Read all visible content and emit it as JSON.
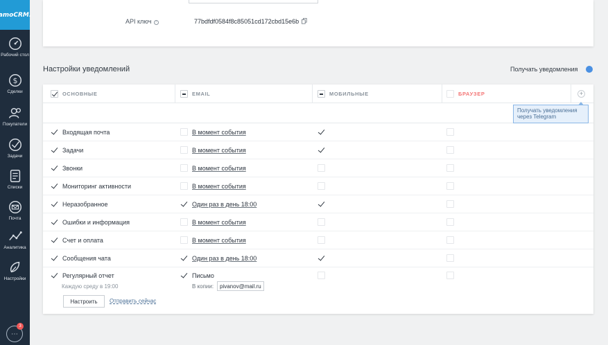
{
  "app": {
    "logo_text": "amoCRM.",
    "accent_color": "#229bd6",
    "sidebar_color": "#1f2d3d"
  },
  "sidebar": {
    "items": [
      {
        "label": "Рабочий стол",
        "icon": "dashboard-icon"
      },
      {
        "label": "Сделки",
        "icon": "deals-icon"
      },
      {
        "label": "Покупатели",
        "icon": "customers-icon"
      },
      {
        "label": "Задачи",
        "icon": "tasks-icon"
      },
      {
        "label": "Списки",
        "icon": "lists-icon"
      },
      {
        "label": "Почта",
        "icon": "mail-icon"
      },
      {
        "label": "Аналитика",
        "icon": "analytics-icon"
      },
      {
        "label": "Настройки",
        "icon": "settings-icon"
      }
    ],
    "chat_badge": "3"
  },
  "api": {
    "label": "API ключ",
    "key": "77bdfdf0584f8c85051cd172cbd15e6b"
  },
  "notifications": {
    "title": "Настройки уведомлений",
    "receive_label": "Получать уведомления",
    "columns": [
      {
        "label": "ОСНОВНЫЕ",
        "state": "checked"
      },
      {
        "label": "EMAIL",
        "state": "partial"
      },
      {
        "label": "МОБИЛЬНЫЕ",
        "state": "partial"
      },
      {
        "label": "БРАУЗЕР",
        "state": "unchecked"
      }
    ],
    "add_column_label": "+",
    "tooltip": "Получать уведомления через Telegram",
    "rows": [
      {
        "label": "Входящая почта",
        "main": true,
        "email": false,
        "email_freq": "В момент события",
        "mobile": true,
        "browser": false
      },
      {
        "label": "Задачи",
        "main": true,
        "email": false,
        "email_freq": "В момент события",
        "mobile": true,
        "browser": false
      },
      {
        "label": "Звонки",
        "main": true,
        "email": false,
        "email_freq": "В момент события",
        "mobile": false,
        "browser": false
      },
      {
        "label": "Мониторинг активности",
        "main": true,
        "email": false,
        "email_freq": "В момент события",
        "mobile": false,
        "browser": false
      },
      {
        "label": "Неразобранное",
        "main": true,
        "email": true,
        "email_freq": "Один раз в день 18:00",
        "mobile": true,
        "browser": false
      },
      {
        "label": "Ошибки и информация",
        "main": true,
        "email": false,
        "email_freq": "В момент события",
        "mobile": false,
        "browser": false
      },
      {
        "label": "Счет и оплата",
        "main": true,
        "email": false,
        "email_freq": "В момент события",
        "mobile": false,
        "browser": false
      },
      {
        "label": "Сообщения чата",
        "main": true,
        "email": true,
        "email_freq": "Один раз в день 18:00",
        "mobile": true,
        "browser": false
      }
    ],
    "report": {
      "label": "Регулярный отчет",
      "schedule": "Каждую среду в 19:00",
      "setup_button": "Настроить",
      "send_now": "Отправить сейчас",
      "email_label": "Письмо",
      "copy_label": "В копии:",
      "copy_email": "pivanov@mail.ru"
    }
  }
}
